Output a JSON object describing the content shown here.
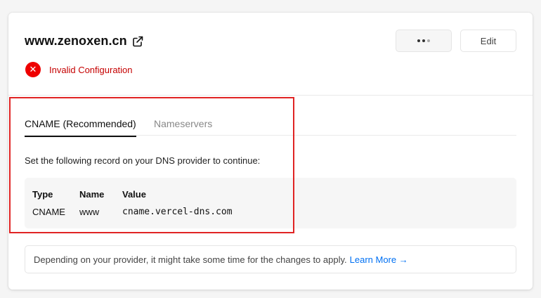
{
  "domain": {
    "name": "www.zenoxen.cn",
    "status": "Invalid Configuration"
  },
  "actions": {
    "more_label": "•••",
    "edit_label": "Edit"
  },
  "tabs": [
    {
      "label": "CNAME (Recommended)",
      "active": true
    },
    {
      "label": "Nameservers",
      "active": false
    }
  ],
  "instruction": "Set the following record on your DNS provider to continue:",
  "record": {
    "headers": {
      "type": "Type",
      "name": "Name",
      "value": "Value"
    },
    "row": {
      "type": "CNAME",
      "name": "www",
      "value": "cname.vercel-dns.com"
    }
  },
  "note": {
    "text": "Depending on your provider, it might take some time for the changes to apply.",
    "link": "Learn More →"
  },
  "colors": {
    "error": "#e00000",
    "link": "#0070f3",
    "highlight_box": "#e02424"
  },
  "icons": {
    "external": "external-link-icon",
    "status": "x-circle-icon"
  }
}
